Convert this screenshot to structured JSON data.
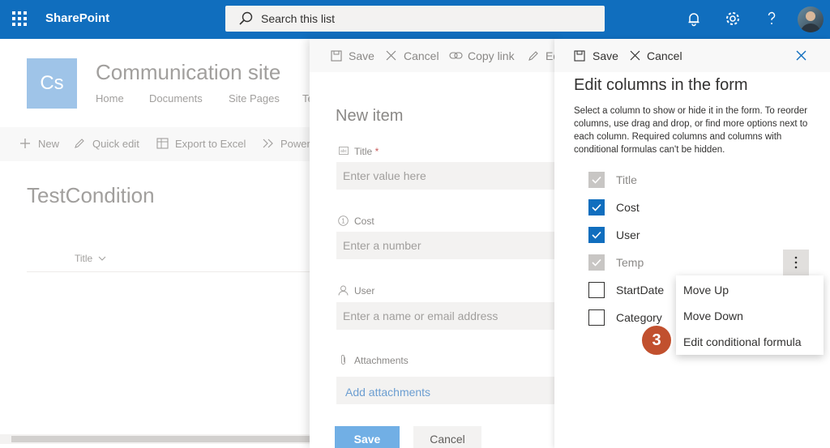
{
  "suitebar": {
    "app_name": "SharePoint",
    "search_placeholder": "Search this list",
    "icons": [
      "waffle-icon",
      "bell-icon",
      "gear-icon",
      "help-icon",
      "avatar"
    ]
  },
  "site": {
    "logo_text": "Cs",
    "title": "Communication site",
    "nav": [
      "Home",
      "Documents",
      "Site Pages",
      "Te"
    ]
  },
  "list_commands": {
    "new": "New",
    "quick_edit": "Quick edit",
    "export": "Export to Excel",
    "power": "Power"
  },
  "list": {
    "title": "TestCondition",
    "column_title": "Title"
  },
  "new_item": {
    "commands": {
      "save": "Save",
      "cancel": "Cancel",
      "copy_link": "Copy link",
      "edit": "Ed"
    },
    "heading": "New item",
    "fields": [
      {
        "label": "Title",
        "required_mark": "*",
        "placeholder": "Enter value here"
      },
      {
        "label": "Cost",
        "placeholder": "Enter a number"
      },
      {
        "label": "User",
        "placeholder": "Enter a name or email address"
      },
      {
        "label": "Attachments",
        "link": "Add attachments"
      }
    ],
    "save_button": "Save",
    "cancel_button": "Cancel"
  },
  "edit_columns": {
    "commands": {
      "save": "Save",
      "cancel": "Cancel"
    },
    "heading": "Edit columns in the form",
    "description": "Select a column to show or hide it in the form. To reorder columns, use drag and drop, or find more options next to each column. Required columns and columns with conditional formulas can't be hidden.",
    "columns": [
      {
        "label": "Title",
        "state": "checked-disabled"
      },
      {
        "label": "Cost",
        "state": "checked"
      },
      {
        "label": "User",
        "state": "checked"
      },
      {
        "label": "Temp",
        "state": "checked-disabled"
      },
      {
        "label": "StartDate",
        "state": "unchecked"
      },
      {
        "label": "Category",
        "state": "unchecked"
      }
    ]
  },
  "context_menu": {
    "items": [
      "Move Up",
      "Move Down",
      "Edit conditional formula"
    ]
  },
  "step_badge": "3",
  "colors": {
    "suitebar": "#106ebe",
    "accent": "#106ebe",
    "badge": "#c1502e"
  }
}
